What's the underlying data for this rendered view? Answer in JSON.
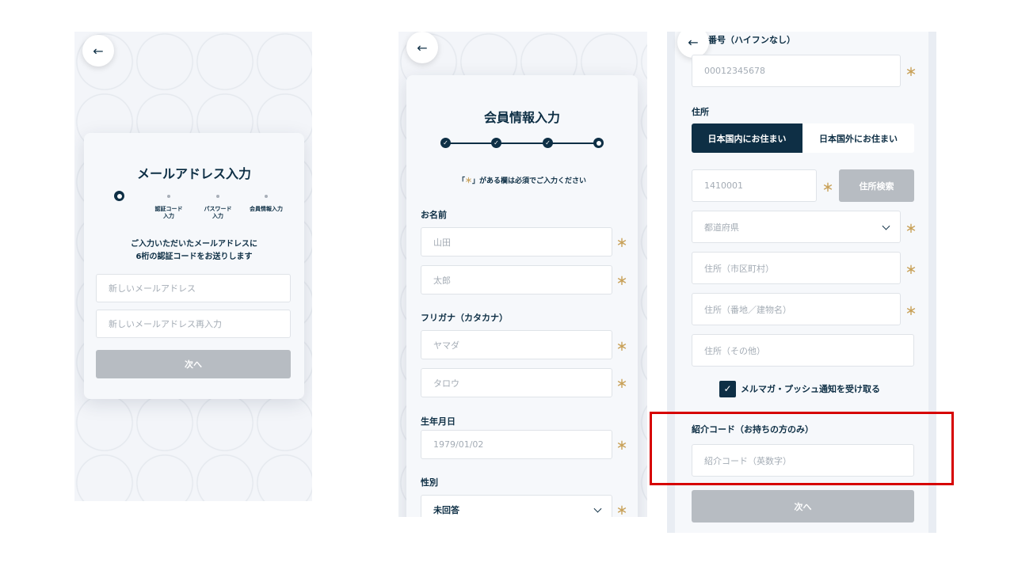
{
  "screen1": {
    "title": "メールアドレス入力",
    "steps": [
      {
        "label": ""
      },
      {
        "label": "認証コード\n入力"
      },
      {
        "label": "パスワード\n入力"
      },
      {
        "label": "会員情報入力"
      }
    ],
    "description_line1": "ご入力いただいたメールアドレスに",
    "description_line2": "6桁の認証コードをお送りします",
    "email_placeholder": "新しいメールアドレス",
    "email_confirm_placeholder": "新しいメールアドレス再入力",
    "next_label": "次へ"
  },
  "screen2": {
    "title": "会員情報入力",
    "required_note_open": "「",
    "required_note_star": "＊",
    "required_note_rest": "」がある欄は必須でご入力ください",
    "name_label": "お名前",
    "last_name_placeholder": "山田",
    "first_name_placeholder": "太郎",
    "kana_label": "フリガナ（カタカナ）",
    "last_kana_placeholder": "ヤマダ",
    "first_kana_placeholder": "タロウ",
    "birth_label": "生年月日",
    "birth_placeholder": "1979/01/02",
    "gender_label": "性別",
    "gender_value": "未回答"
  },
  "screen3": {
    "phone_label_partial": "番号（ハイフンなし）",
    "phone_placeholder": "00012345678",
    "address_label": "住所",
    "domestic_label": "日本国内にお住まい",
    "overseas_label": "日本国外にお住まい",
    "zip_placeholder": "1410001",
    "address_search_label": "住所検索",
    "prefecture_placeholder": "都道府県",
    "city_placeholder": "住所（市区町村）",
    "street_placeholder": "住所（番地／建物名）",
    "other_placeholder": "住所（その他）",
    "newsletter_label": "メルマガ・プッシュ通知を受け取る",
    "referral_label": "紹介コード（お持ちの方のみ）",
    "referral_placeholder": "紹介コード（英数字）",
    "next_label": "次へ"
  },
  "required_mark": "＊",
  "colors": {
    "primary": "#0e2f45",
    "accent_star": "#c9a25a",
    "disabled_button": "#b7bcc2",
    "highlight": "#d60000"
  }
}
